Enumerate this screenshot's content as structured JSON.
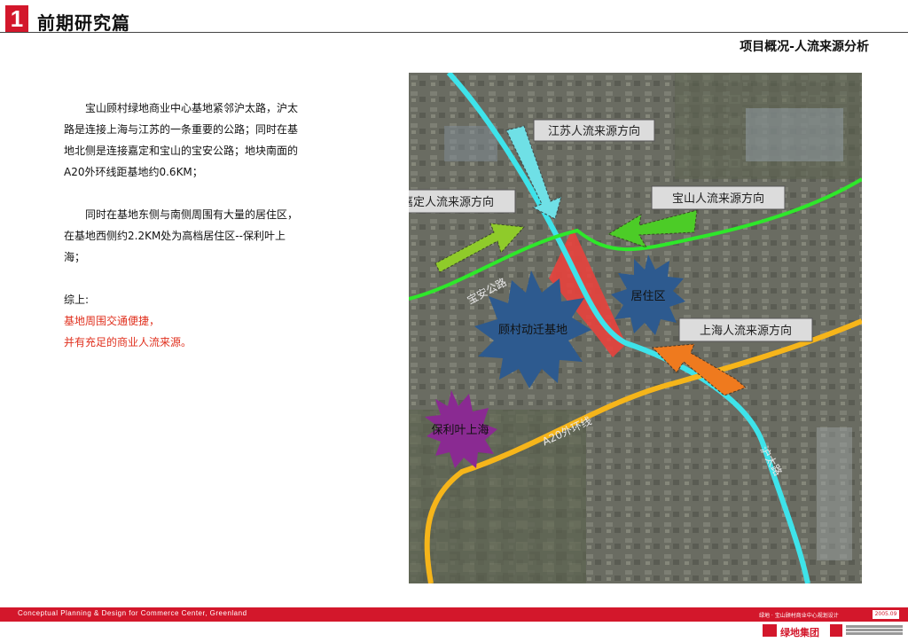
{
  "header": {
    "number": "1",
    "title": "前期研究篇",
    "subtitle": "项目概况-人流来源分析"
  },
  "body": {
    "para1": "宝山顾村绿地商业中心基地紧邻沪太路，沪太路是连接上海与江苏的一条重要的公路；同时在基地北侧是连接嘉定和宝山的宝安公路；地块南面的A20外环线距基地约0.6KM；",
    "para2": "同时在基地东侧与南侧周围有大量的居住区，在基地西侧约2.2KM处为高档居住区--保利叶上海；",
    "summary_label": "综上:",
    "summary_line1": "基地周围交通便捷，",
    "summary_line2": "并有充足的商业人流来源。"
  },
  "map": {
    "labels": {
      "jiangsu": "江苏人流来源方向",
      "baoshan": "宝山人流来源方向",
      "jiading": "嘉定人流来源方向",
      "shanghai": "上海人流来源方向",
      "baoan_road": "宝安公路",
      "residential": "居住区",
      "site": "顾村动迁基地",
      "poly": "保利叶上海",
      "a20": "A20外环线",
      "hutai_road": "沪太路"
    },
    "colors": {
      "hutai": "#3ee3ea",
      "baoan": "#2ee82a",
      "a20": "#f6b51a",
      "site": "#e8433d",
      "residential": "#2d5a8f",
      "poly": "#8a2a92",
      "jiangsu_arrow": "#6fe0e6",
      "baoshan_arrow": "#4ccc27",
      "jiading_arrow": "#8fcb2a",
      "shanghai_arrow": "#ef7a1e"
    }
  },
  "footer": {
    "left": "Conceptual Planning & Design for Commerce Center, Greenland",
    "right": "绿地 · 宝山顾村商业中心规划设计",
    "date": "2005.09",
    "logo_text": "绿地集团"
  }
}
